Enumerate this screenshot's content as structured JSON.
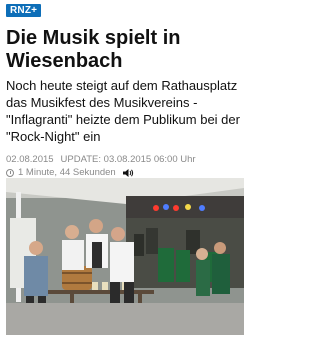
{
  "brand": {
    "label": "RNZ+"
  },
  "article": {
    "headline": "Die Musik spielt in Wiesenbach",
    "teaser": "Noch heute steigt auf dem Rathausplatz das Musikfest des Musikvereins - \"Inflagranti\" heizte dem Publikum bei der \"Rock-Night\" ein",
    "published": "02.08.2015",
    "update_label": "UPDATE: 03.08.2015 06:00 Uhr",
    "reading_time": "1 Minute, 44 Sekunden"
  },
  "icons": {
    "clock": "clock-icon",
    "audio": "speaker-icon"
  },
  "colors": {
    "brand": "#0d6eb8",
    "meta": "#8a8a8a"
  }
}
